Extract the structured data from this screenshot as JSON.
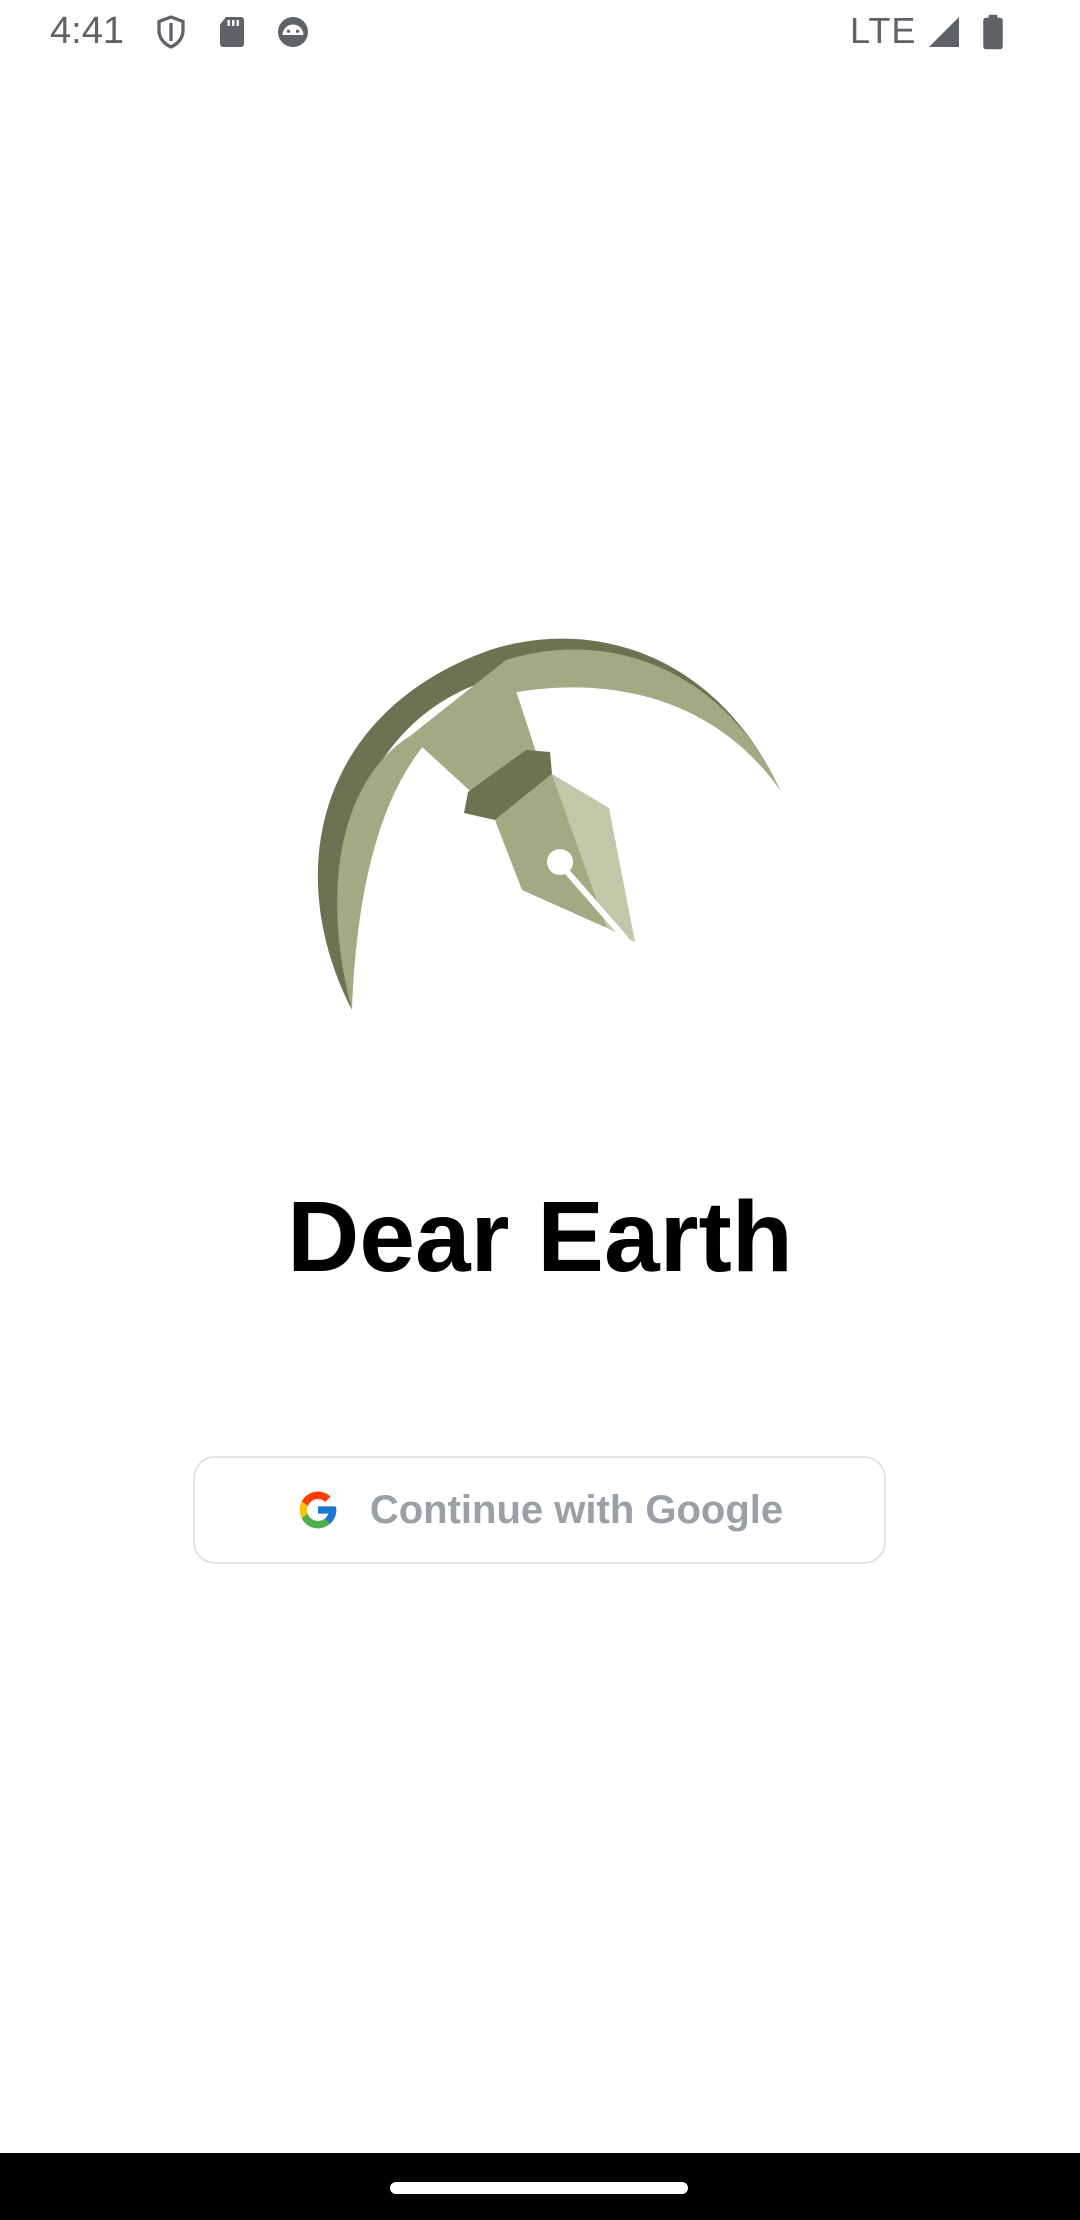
{
  "status_bar": {
    "time": "4:41",
    "network": "LTE",
    "icons": [
      "shield-icon",
      "sd-card-icon",
      "android-face-icon",
      "signal-icon",
      "battery-icon"
    ],
    "icon_color": "#5f6368"
  },
  "logo": {
    "icon": "pen-nib-earth-logo",
    "colors": {
      "dark": "#6b7352",
      "mid": "#a3aa83",
      "light": "#c2c7a9"
    }
  },
  "app": {
    "title": "Dear Earth"
  },
  "auth": {
    "google_button_label": "Continue with Google",
    "icon": "google-g-icon"
  },
  "navigation": {
    "handle": "home-gesture-handle"
  }
}
